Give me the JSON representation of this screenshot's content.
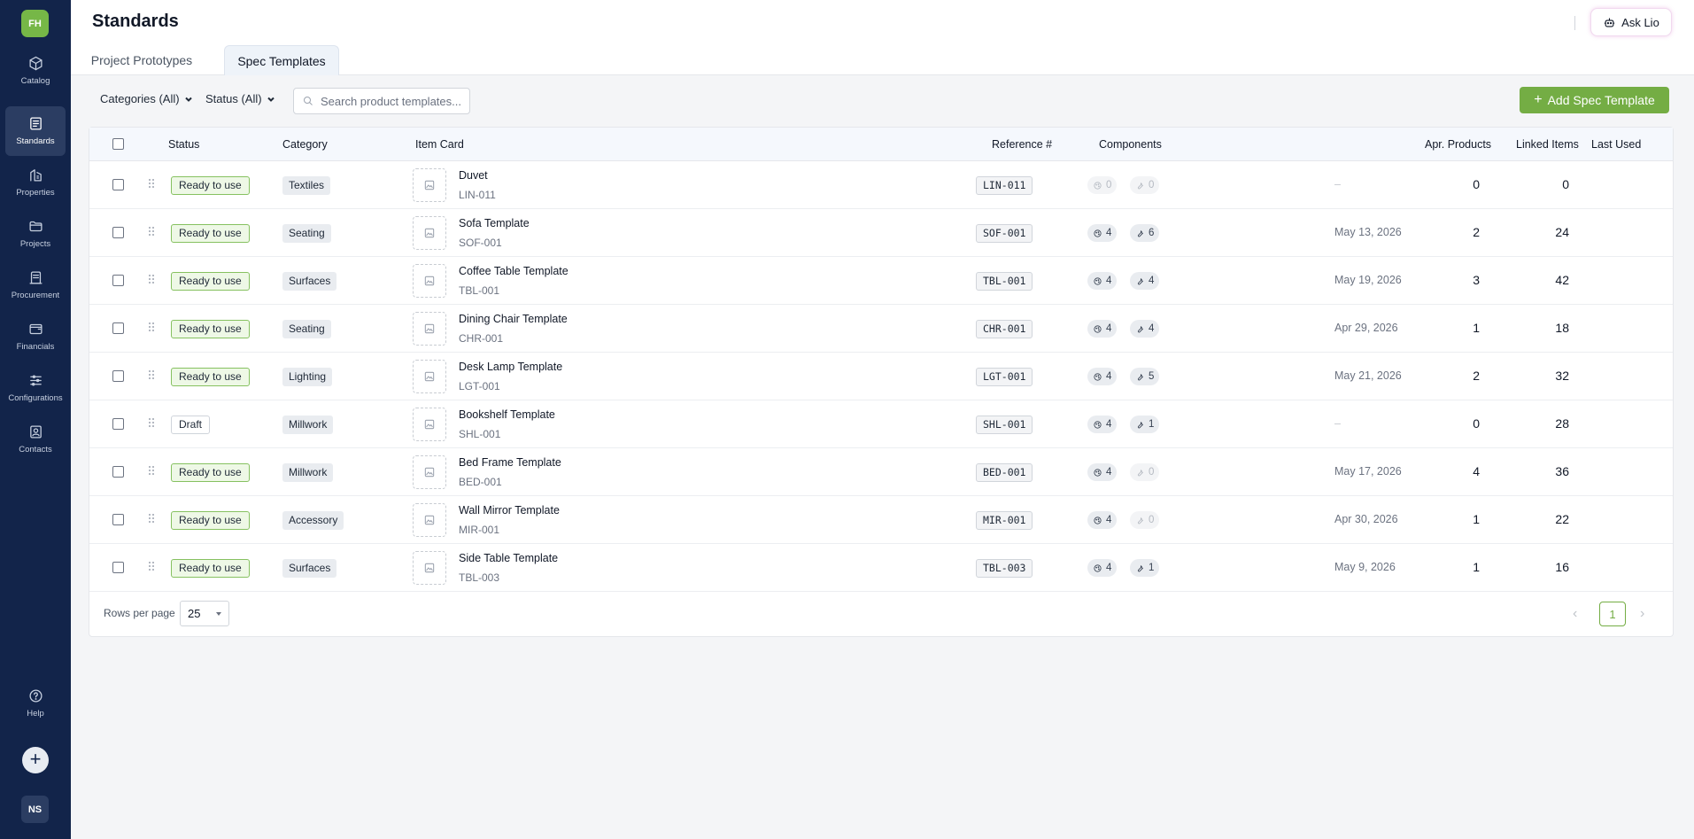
{
  "sidebar": {
    "org_initials": "FH",
    "user_initials": "NS",
    "items": [
      {
        "label": "Catalog",
        "icon": "box-icon"
      },
      {
        "label": "Standards",
        "icon": "document-icon"
      },
      {
        "label": "Properties",
        "icon": "building-icon"
      },
      {
        "label": "Projects",
        "icon": "folder-icon"
      },
      {
        "label": "Procurement",
        "icon": "receipt-icon"
      },
      {
        "label": "Financials",
        "icon": "wallet-icon"
      },
      {
        "label": "Configurations",
        "icon": "sliders-icon"
      },
      {
        "label": "Contacts",
        "icon": "contact-icon"
      }
    ],
    "help_label": "Help",
    "add_symbol": "+"
  },
  "header": {
    "title": "Standards",
    "ask_label": "Ask Lio"
  },
  "tabs": [
    {
      "label": "Project Prototypes",
      "active": false
    },
    {
      "label": "Spec Templates",
      "active": true
    }
  ],
  "filters": {
    "categories": "Categories (All)",
    "status": "Status (All)",
    "search_placeholder": "Search product templates..."
  },
  "actions": {
    "add_spec_label": "Add Spec Template"
  },
  "table": {
    "columns": {
      "status": "Status",
      "category": "Category",
      "item_card": "Item Card",
      "reference": "Reference #",
      "components": "Components",
      "apr_products": "Apr. Products",
      "linked_items": "Linked Items",
      "last_used": "Last Used"
    },
    "rows": [
      {
        "status": "Ready to use",
        "category": "Textiles",
        "name": "Duvet",
        "code": "LIN-011",
        "ref": "LIN-011",
        "comp_a": "0",
        "comp_b": "0",
        "apr": "0",
        "linked": "0",
        "last_used": "–"
      },
      {
        "status": "Ready to use",
        "category": "Seating",
        "name": "Sofa Template",
        "code": "SOF-001",
        "ref": "SOF-001",
        "comp_a": "4",
        "comp_b": "6",
        "apr": "2",
        "linked": "24",
        "last_used": "May 13, 2026"
      },
      {
        "status": "Ready to use",
        "category": "Surfaces",
        "name": "Coffee Table Template",
        "code": "TBL-001",
        "ref": "TBL-001",
        "comp_a": "4",
        "comp_b": "4",
        "apr": "3",
        "linked": "42",
        "last_used": "May 19, 2026"
      },
      {
        "status": "Ready to use",
        "category": "Seating",
        "name": "Dining Chair Template",
        "code": "CHR-001",
        "ref": "CHR-001",
        "comp_a": "4",
        "comp_b": "4",
        "apr": "1",
        "linked": "18",
        "last_used": "Apr 29, 2026"
      },
      {
        "status": "Ready to use",
        "category": "Lighting",
        "name": "Desk Lamp Template",
        "code": "LGT-001",
        "ref": "LGT-001",
        "comp_a": "4",
        "comp_b": "5",
        "apr": "2",
        "linked": "32",
        "last_used": "May 21, 2026"
      },
      {
        "status": "Draft",
        "category": "Millwork",
        "name": "Bookshelf Template",
        "code": "SHL-001",
        "ref": "SHL-001",
        "comp_a": "4",
        "comp_b": "1",
        "apr": "0",
        "linked": "28",
        "last_used": "–"
      },
      {
        "status": "Ready to use",
        "category": "Millwork",
        "name": "Bed Frame Template",
        "code": "BED-001",
        "ref": "BED-001",
        "comp_a": "4",
        "comp_b": "0",
        "apr": "4",
        "linked": "36",
        "last_used": "May 17, 2026"
      },
      {
        "status": "Ready to use",
        "category": "Accessory",
        "name": "Wall Mirror Template",
        "code": "MIR-001",
        "ref": "MIR-001",
        "comp_a": "4",
        "comp_b": "0",
        "apr": "1",
        "linked": "22",
        "last_used": "Apr 30, 2026"
      },
      {
        "status": "Ready to use",
        "category": "Surfaces",
        "name": "Side Table Template",
        "code": "TBL-003",
        "ref": "TBL-003",
        "comp_a": "4",
        "comp_b": "1",
        "apr": "1",
        "linked": "16",
        "last_used": "May 9, 2026"
      }
    ]
  },
  "pagination": {
    "rows_per_page_label": "Rows per page",
    "rows_per_page": "25",
    "current_page": "1",
    "prev": "‹",
    "next": "›"
  },
  "colors": {
    "sidebar_bg": "#12244a",
    "accent_green": "#74ad44",
    "status_ready_bg": "#eef8e6"
  }
}
